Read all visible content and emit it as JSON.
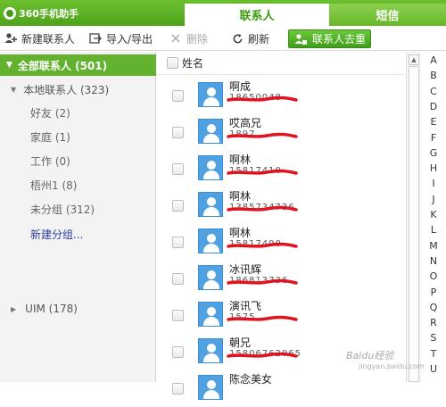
{
  "app": {
    "title": "360手机助手"
  },
  "tabs": [
    {
      "label": "联系人",
      "active": true
    },
    {
      "label": "短信",
      "active": false
    }
  ],
  "toolbar": {
    "new_contact": "新建联系人",
    "import_export": "导入/导出",
    "delete": "删除",
    "refresh": "刷新",
    "dedup": "联系人去重"
  },
  "sidebar": {
    "all": {
      "label": "全部联系人 (501)"
    },
    "local": {
      "label": "本地联系人 (323)"
    },
    "groups": [
      {
        "label": "好友 (2)"
      },
      {
        "label": "家庭 (1)"
      },
      {
        "label": "工作 (0)"
      },
      {
        "label": "梧州1 (8)"
      },
      {
        "label": "未分组 (312)"
      }
    ],
    "new_group": "新建分组...",
    "uim": {
      "label": "UIM (178)"
    }
  },
  "list": {
    "header": "姓名",
    "contacts": [
      {
        "name": "啊成",
        "phone": "18650048"
      },
      {
        "name": "哎高兄",
        "phone": "1897"
      },
      {
        "name": "啊林",
        "phone": "15817410"
      },
      {
        "name": "啊林",
        "phone": "1385734736"
      },
      {
        "name": "啊林",
        "phone": "15817490"
      },
      {
        "name": "冰讯辉",
        "phone": "186813736"
      },
      {
        "name": "演讯飞",
        "phone": "1575"
      },
      {
        "name": "朝兄",
        "phone": "15806762065"
      },
      {
        "name": "陈念美女",
        "phone": ""
      }
    ]
  },
  "alphabet": [
    "A",
    "B",
    "C",
    "D",
    "E",
    "F",
    "G",
    "H",
    "I",
    "J",
    "K",
    "L",
    "M",
    "N",
    "O",
    "P",
    "Q",
    "R",
    "S",
    "T",
    "U"
  ],
  "watermark": {
    "main": "Baidu经验",
    "sub": "jingyan.baidu.com"
  },
  "colors": {
    "accent": "#4fa31b",
    "selected": "#63b22f",
    "avatar": "#4fa1e2",
    "redact": "#e0131f"
  }
}
